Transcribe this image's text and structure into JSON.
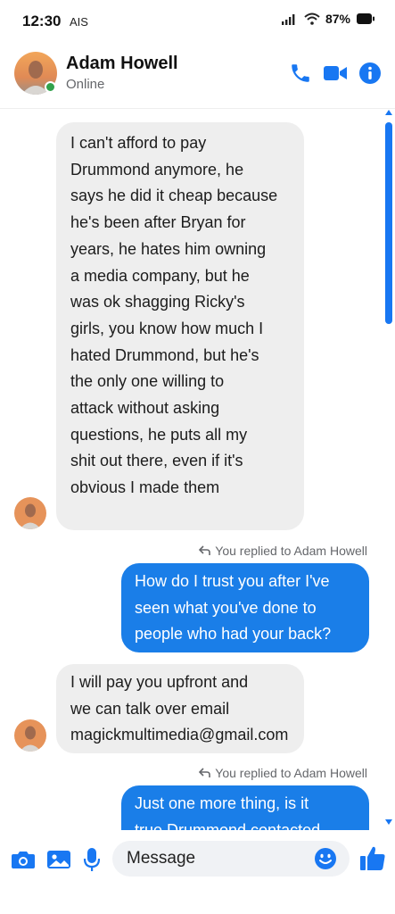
{
  "status_bar": {
    "time": "12:30",
    "carrier": "AIS",
    "battery": "87%"
  },
  "header": {
    "name": "Adam Howell",
    "status": "Online"
  },
  "messages": [
    {
      "direction": "incoming",
      "lines": [
        "I can't afford to pay",
        "Drummond anymore, he",
        "says he did it cheap because",
        "he's been after Bryan for",
        "years, he hates him owning",
        "a media company, but he",
        "was ok shagging Ricky's",
        "girls, you know how much I",
        "hated Drummond, but he's",
        "the only one willing to",
        "attack without asking",
        "questions, he puts all my",
        "shit out there, even if it's",
        "obvious I made them"
      ]
    },
    {
      "direction": "outgoing",
      "reply_label": "You replied to Adam Howell",
      "lines": [
        "How do I trust you after I've",
        "seen what you've done to",
        "people who had your back?"
      ]
    },
    {
      "direction": "incoming",
      "lines": [
        "I will pay you upfront and",
        "we can talk over email",
        "magickmultimedia@gmail.com"
      ]
    },
    {
      "direction": "outgoing",
      "reply_label": "You replied to Adam Howell",
      "lines": [
        "Just one more thing, is it",
        "true Drummond contacted"
      ]
    }
  ],
  "composer": {
    "placeholder": "Message"
  },
  "icons": {
    "phone": "phone-icon",
    "video": "video-camera-icon",
    "info": "info-icon",
    "camera": "camera-icon",
    "gallery": "image-icon",
    "mic": "microphone-icon",
    "emoji": "emoji-icon",
    "like": "thumbs-up-icon"
  },
  "colors": {
    "accent": "#1877f2",
    "outgoing_bubble": "#1a7ee8",
    "incoming_bubble": "#eeeeee",
    "online": "#31a24c"
  }
}
